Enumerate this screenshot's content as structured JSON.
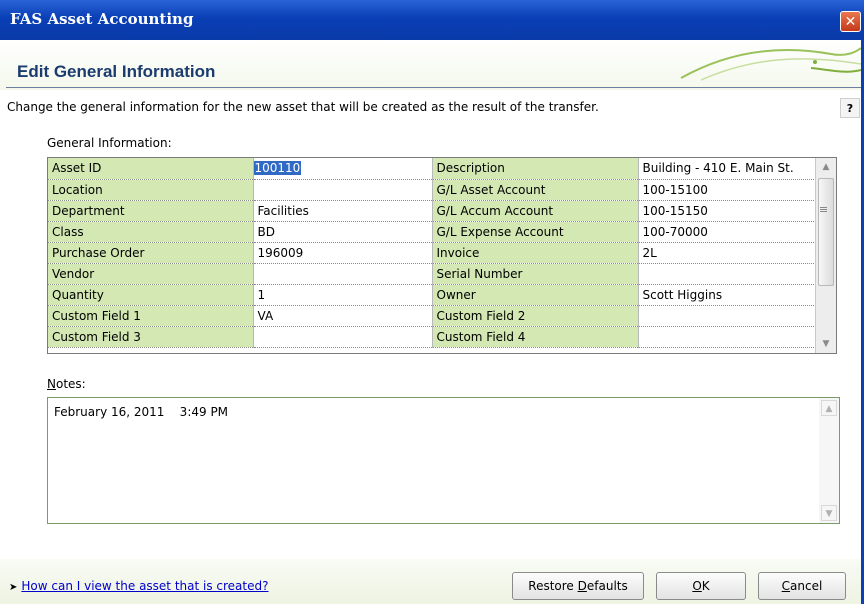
{
  "window": {
    "title": "FAS Asset Accounting",
    "close_glyph": "✕"
  },
  "page": {
    "title": "Edit General Information",
    "description": "Change the general information for the new asset that will be created as the result of the transfer.",
    "help_glyph": "?"
  },
  "general": {
    "label": "General Information:",
    "rows": [
      {
        "l1": "Asset ID",
        "v1": "100110",
        "l2": "Description",
        "v2": "Building - 410 E. Main St."
      },
      {
        "l1": "Location",
        "v1": "",
        "l2": "G/L Asset Account",
        "v2": "100-15100"
      },
      {
        "l1": "Department",
        "v1": "Facilities",
        "l2": "G/L Accum Account",
        "v2": "100-15150"
      },
      {
        "l1": "Class",
        "v1": "BD",
        "l2": "G/L Expense Account",
        "v2": "100-70000"
      },
      {
        "l1": "Purchase Order",
        "v1": "196009",
        "l2": "Invoice",
        "v2": "2L"
      },
      {
        "l1": "Vendor",
        "v1": "",
        "l2": "Serial Number",
        "v2": ""
      },
      {
        "l1": "Quantity",
        "v1": "1",
        "l2": "Owner",
        "v2": "Scott Higgins"
      },
      {
        "l1": "Custom Field  1",
        "v1": "VA",
        "l2": "Custom Field  2",
        "v2": ""
      },
      {
        "l1": "Custom Field  3",
        "v1": "",
        "l2": "Custom Field  4",
        "v2": ""
      }
    ],
    "selected_cell": "Asset ID"
  },
  "notes": {
    "label_underlined": "N",
    "label_rest": "otes:",
    "content": "February 16, 2011    3:49 PM"
  },
  "footer": {
    "help_link": "How can I view the asset that is created?",
    "restore_prefix": "Restore ",
    "restore_ul": "D",
    "restore_suffix": "efaults",
    "ok_ul": "O",
    "ok_rest": "K",
    "cancel_ul": "C",
    "cancel_rest": "ancel"
  },
  "colors": {
    "titlebar": "#0a3fb6",
    "label_cell": "#d3e8b3",
    "selection": "#316ac5",
    "title_text": "#1a3c6e"
  }
}
